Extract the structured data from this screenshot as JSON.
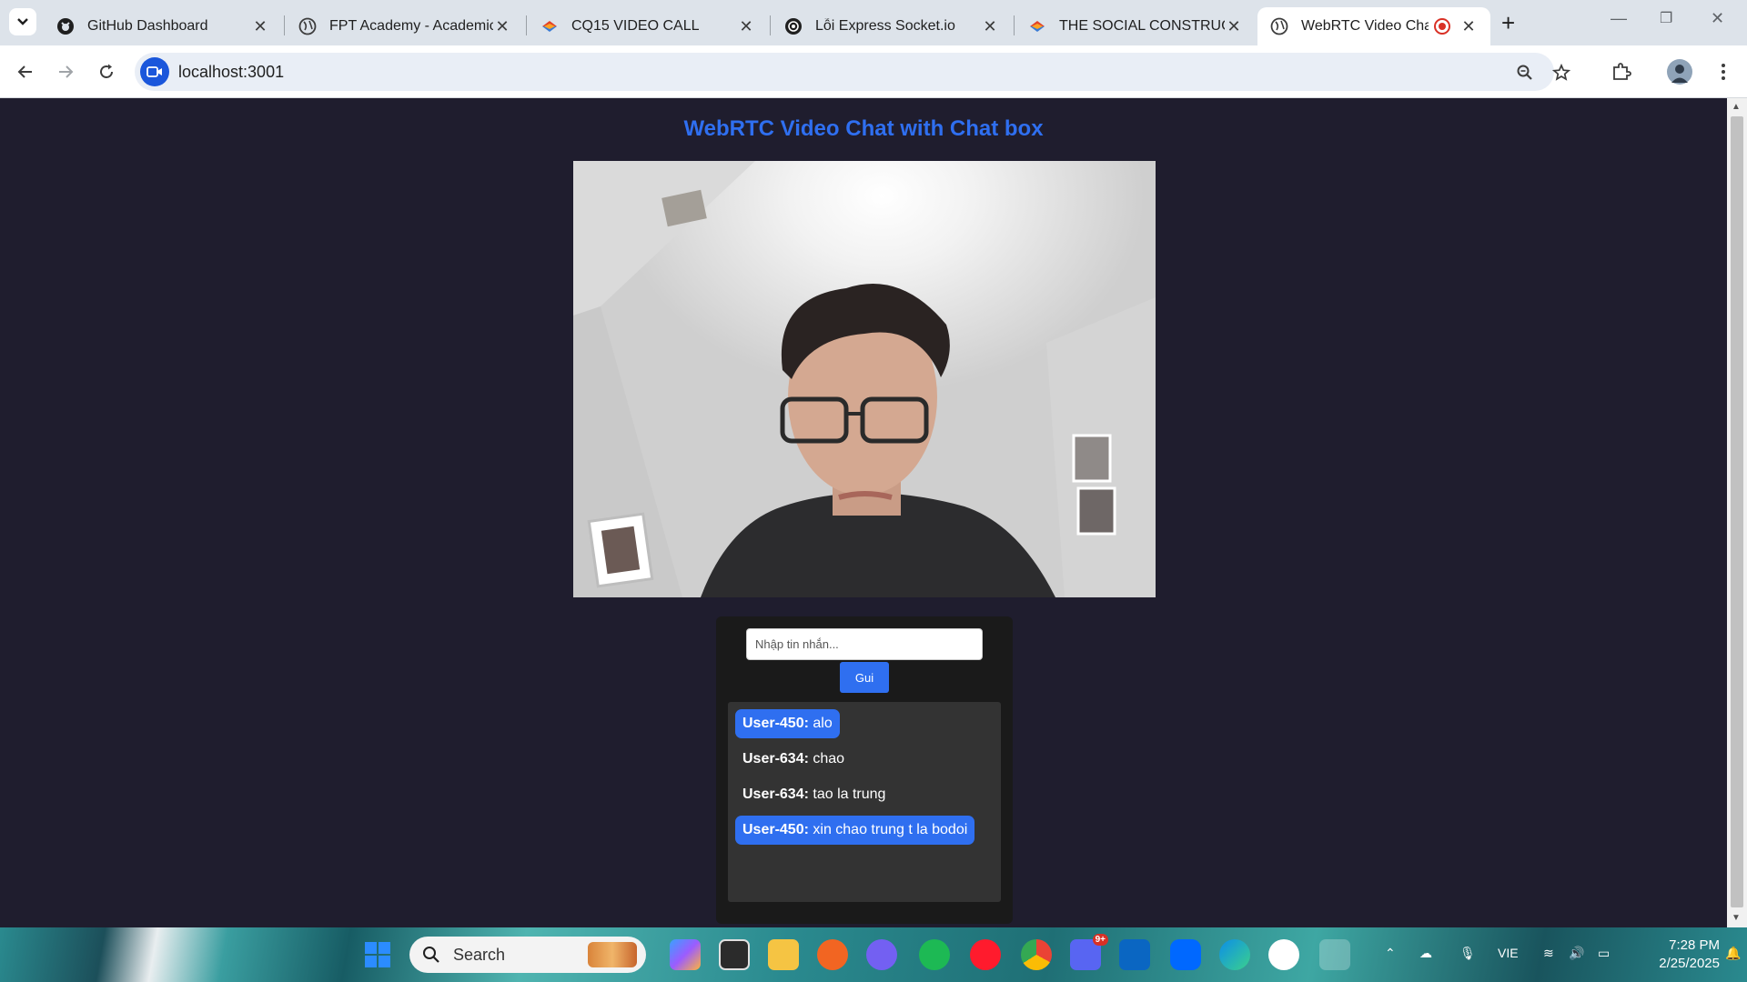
{
  "browser": {
    "tabs": [
      {
        "title": "GitHub Dashboard",
        "icon": "github-icon",
        "active": false
      },
      {
        "title": "FPT Academy - Academic Portal",
        "icon": "globe-icon",
        "active": false
      },
      {
        "title": "CQ15 VIDEO CALL",
        "icon": "gitlab-icon",
        "active": false
      },
      {
        "title": "Lỗi Express Socket.io",
        "icon": "chatgpt-icon",
        "active": false
      },
      {
        "title": "THE SOCIAL CONSTRUCTIVISM",
        "icon": "gitlab-icon",
        "active": false
      },
      {
        "title": "WebRTC Video Chat with Chat box",
        "icon": "globe-icon",
        "active": true
      }
    ],
    "new_tab_label": "+",
    "address": "localhost:3001"
  },
  "page": {
    "title": "WebRTC Video Chat with Chat box",
    "chat": {
      "input_placeholder": "Nhập tin nhắn...",
      "input_value": "",
      "send_label": "Gui",
      "messages": [
        {
          "user": "User-450:",
          "text": " alo",
          "mine": true
        },
        {
          "user": "User-634:",
          "text": " chao",
          "mine": false
        },
        {
          "user": "User-634:",
          "text": " tao la trung",
          "mine": false
        },
        {
          "user": "User-450:",
          "text": " xin chao trung t la bodoi",
          "mine": true
        }
      ]
    }
  },
  "taskbar": {
    "search_label": "Search",
    "language": "VIE",
    "time": "7:28 PM",
    "date": "2/25/2025",
    "discord_badge": "9+"
  },
  "colors": {
    "page_bg": "#1f1d2e",
    "accent": "#2f6ff0"
  }
}
